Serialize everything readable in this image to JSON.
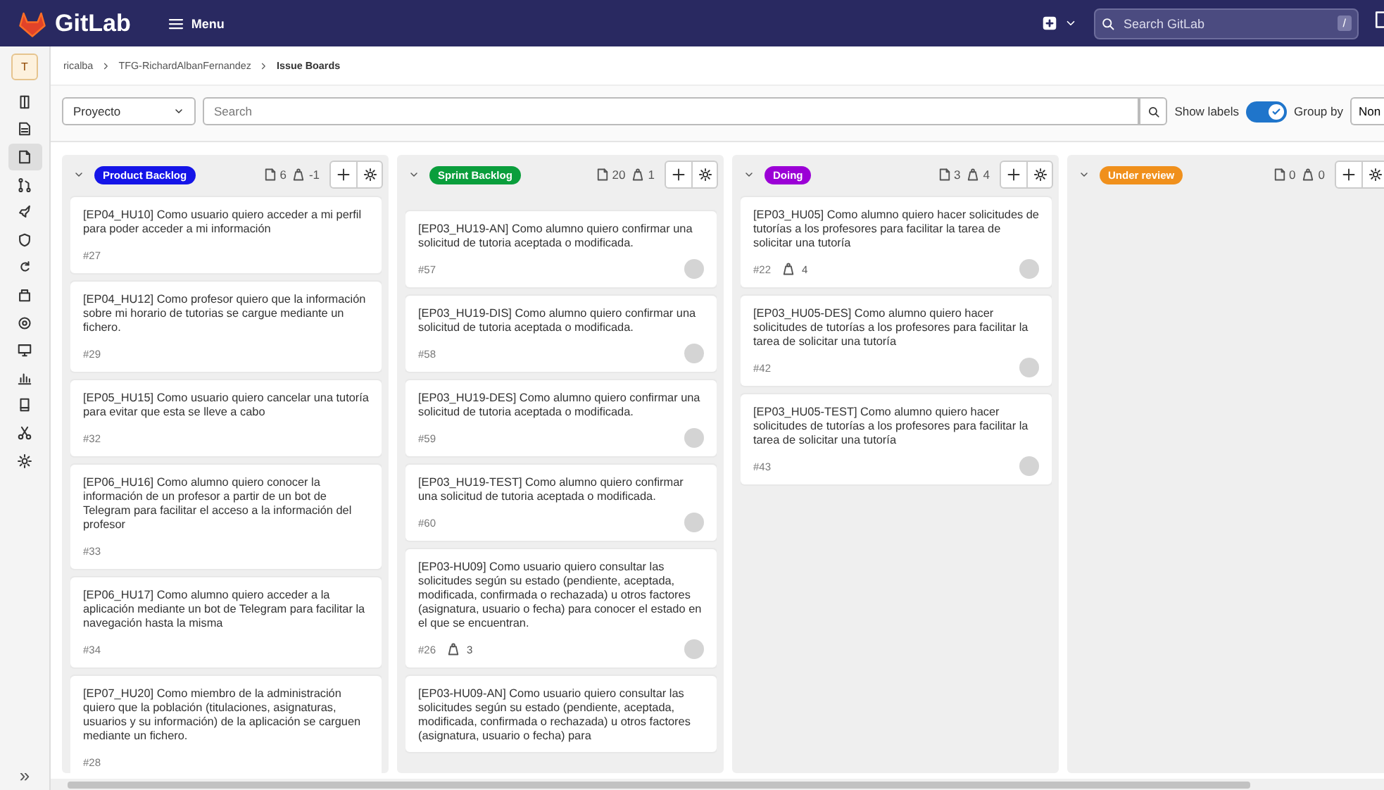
{
  "nav": {
    "logo": "GitLab",
    "menu": "Menu",
    "search": {
      "placeholder": "Search GitLab"
    },
    "shortcut": "/"
  },
  "sidebar": {
    "avatar": "T",
    "items": [
      {
        "selected": false
      },
      {
        "selected": false
      },
      {
        "selected": true
      },
      {
        "selected": false
      },
      {
        "selected": false
      },
      {
        "selected": false
      },
      {
        "selected": false
      },
      {
        "selected": false
      },
      {
        "selected": false
      },
      {
        "selected": false
      },
      {
        "selected": false
      },
      {
        "selected": false
      },
      {
        "selected": false
      },
      {
        "selected": false
      }
    ],
    "collapse": "»"
  },
  "breadcrumbs": [
    "ricalba",
    "TFG-RichardAlbanFernandez",
    "Issue Boards"
  ],
  "filter_bar": {
    "scope": "Proyecto",
    "search": {
      "placeholder": "Search"
    },
    "show_labels": {
      "label": "Show labels",
      "on": true
    },
    "group_by": {
      "label": "Group by",
      "value": "Non"
    }
  },
  "columns": [
    {
      "title": "Product Backlog",
      "color": "#1515e8",
      "issue_count": "6",
      "weight": "-1",
      "cards": [
        {
          "title": "[EP04_HU10] Como usuario quiero acceder a mi perfil para poder acceder a mi información",
          "number": "#27",
          "assigned": false
        },
        {
          "title": "[EP04_HU12] Como profesor quiero que la información sobre mi horario de tutorias se cargue mediante un fichero.",
          "number": "#29",
          "assigned": false
        },
        {
          "title": "[EP05_HU15] Como usuario quiero cancelar una tutoría para evitar que esta se lleve a cabo",
          "number": "#32",
          "assigned": false
        },
        {
          "title": "[EP06_HU16] Como alumno quiero conocer la información de un profesor a partir de un bot de Telegram para facilitar el acceso a la información del profesor",
          "number": "#33",
          "assigned": false
        },
        {
          "title": "[EP06_HU17] Como alumno quiero acceder a la aplicación mediante un bot de Telegram para facilitar la navegación hasta la misma",
          "number": "#34",
          "assigned": false
        },
        {
          "title": "[EP07_HU20] Como miembro de la administración quiero que la población (titulaciones, asignaturas, usuarios y su información) de la aplicación se carguen mediante un fichero.",
          "number": "#28",
          "assigned": false
        }
      ]
    },
    {
      "title": "Sprint Backlog",
      "color": "#0a9e3c",
      "issue_count": "20",
      "weight": "1",
      "cards": [
        {
          "title": "[EP03_HU19-AN] Como alumno quiero confirmar una solicitud de tutoria aceptada o modificada.",
          "number": "#57",
          "assigned": true
        },
        {
          "title": "[EP03_HU19-DIS] Como alumno quiero confirmar una solicitud de tutoria aceptada o modificada.",
          "number": "#58",
          "assigned": true
        },
        {
          "title": "[EP03_HU19-DES] Como alumno quiero confirmar una solicitud de tutoria aceptada o modificada.",
          "number": "#59",
          "assigned": true
        },
        {
          "title": "[EP03_HU19-TEST] Como alumno quiero confirmar una solicitud de tutoria aceptada o modificada.",
          "number": "#60",
          "assigned": true
        },
        {
          "title": "[EP03-HU09] Como usuario quiero consultar las solicitudes según su estado (pendiente, aceptada, modificada, confirmada o rechazada) u otros factores (asignatura, usuario o fecha) para conocer el estado en el que se encuentran.",
          "number": "#26",
          "weight": "3",
          "assigned": true
        },
        {
          "title": "[EP03-HU09-AN] Como usuario quiero consultar las solicitudes según su estado (pendiente, aceptada, modificada, confirmada o rechazada) u otros factores (asignatura, usuario o fecha) para",
          "assigned": false
        }
      ]
    },
    {
      "title": "Doing",
      "color": "#9b00d6",
      "issue_count": "3",
      "weight": "4",
      "cards": [
        {
          "title": "[EP03_HU05] Como alumno quiero hacer solicitudes de tutorías a los profesores para facilitar la tarea de solicitar una tutoría",
          "number": "#22",
          "weight": "4",
          "assigned": true
        },
        {
          "title": "[EP03_HU05-DES] Como alumno quiero hacer solicitudes de tutorías a los profesores para facilitar la tarea de solicitar una tutoría",
          "number": "#42",
          "assigned": true
        },
        {
          "title": "[EP03_HU05-TEST] Como alumno quiero hacer solicitudes de tutorías a los profesores para facilitar la tarea de solicitar una tutoría",
          "number": "#43",
          "assigned": true
        }
      ]
    },
    {
      "title": "Under review",
      "color": "#f0901c",
      "issue_count": "0",
      "weight": "0"
    }
  ]
}
